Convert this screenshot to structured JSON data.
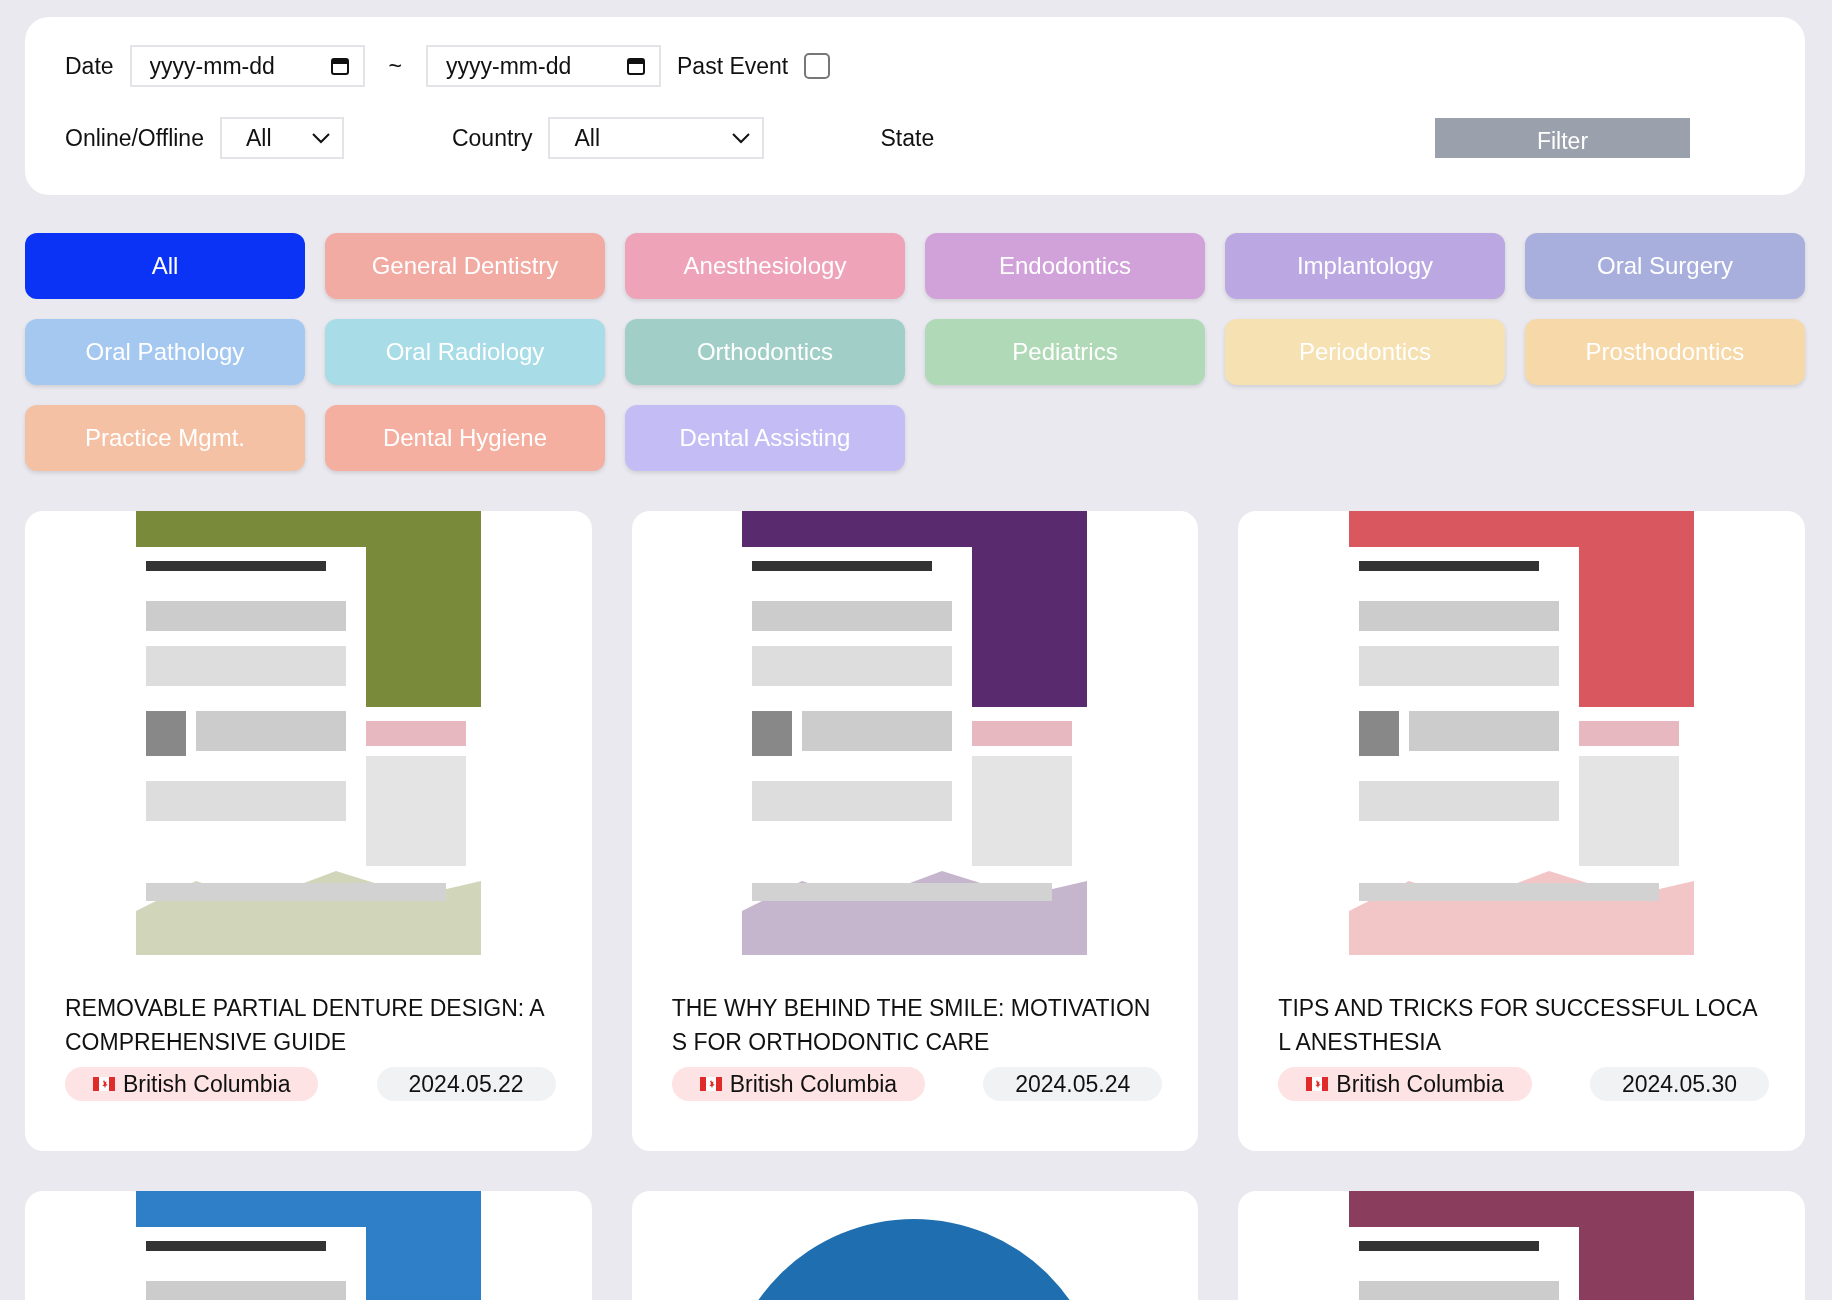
{
  "filters": {
    "date_label": "Date",
    "date_from": {
      "placeholder": "yyyy-mm-dd"
    },
    "separator": "~",
    "date_to": {
      "placeholder": "yyyy-mm-dd"
    },
    "past_event": {
      "label": "Past Event",
      "checked": false
    },
    "online_label": "Online/Offline",
    "online_value": "All",
    "country_label": "Country",
    "country_value": "All",
    "state_label": "State",
    "filter_button": "Filter"
  },
  "categories": [
    {
      "label": "All",
      "color": "#0a33f5",
      "selected": true
    },
    {
      "label": "General Dentistry",
      "color": "#f2aba3",
      "selected": false
    },
    {
      "label": "Anesthesiology",
      "color": "#eea3b8",
      "selected": false
    },
    {
      "label": "Endodontics",
      "color": "#d1a2d9",
      "selected": false
    },
    {
      "label": "Implantology",
      "color": "#bba8e2",
      "selected": false
    },
    {
      "label": "Oral Surgery",
      "color": "#a8afdd",
      "selected": false
    },
    {
      "label": "Oral Pathology",
      "color": "#a5c8f1",
      "selected": false
    },
    {
      "label": "Oral Radiology",
      "color": "#a8dce7",
      "selected": false
    },
    {
      "label": "Orthodontics",
      "color": "#a1cfc7",
      "selected": false
    },
    {
      "label": "Pediatrics",
      "color": "#b0d9b7",
      "selected": false
    },
    {
      "label": "Periodontics",
      "color": "#f5e1b2",
      "selected": false
    },
    {
      "label": "Prosthodontics",
      "color": "#f7d8a8",
      "selected": false
    },
    {
      "label": "Practice Mgmt.",
      "color": "#f4c1a4",
      "selected": false
    },
    {
      "label": "Dental Hygiene",
      "color": "#f4afa0",
      "selected": false
    },
    {
      "label": "Dental Assisting",
      "color": "#c4bdf5",
      "selected": false
    }
  ],
  "events": [
    {
      "poster": {
        "kind": "picture"
      },
      "title": "REMOVABLE PARTIAL DENTURE DESIGN: A COMPREHENSIVE GUIDE",
      "region": "British Columbia",
      "date": "2024.05.22"
    },
    {
      "poster": {
        "kind": "picture"
      },
      "title": "THE WHY BEHIND THE SMILE: MOTIVATIONS FOR ORTHODONTIC CARE",
      "region": "British Columbia",
      "date": "2024.05.24"
    },
    {
      "poster": {
        "kind": "picture"
      },
      "title": "TIPS AND TRICKS FOR SUCCESSFUL LOCAL ANESTHESIA",
      "region": "British Columbia",
      "date": "2024.05.30"
    },
    {
      "poster": {
        "kind": "picture"
      }
    },
    {
      "poster": {
        "kind": "picture"
      }
    },
    {
      "poster": {
        "kind": "picture"
      }
    }
  ]
}
